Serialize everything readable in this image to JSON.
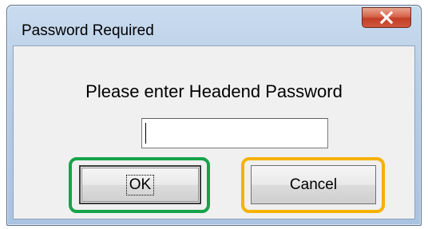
{
  "window": {
    "title": "Password Required",
    "close_icon": "close-x-icon"
  },
  "dialog": {
    "prompt": "Please enter Headend Password",
    "password_value": ""
  },
  "buttons": {
    "ok_label": "OK",
    "cancel_label": "Cancel"
  },
  "highlight_colors": {
    "ok": "#16a34a",
    "cancel": "#f5b100"
  }
}
